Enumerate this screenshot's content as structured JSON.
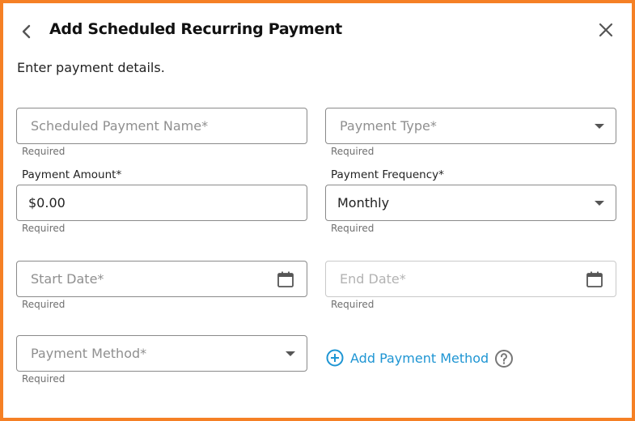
{
  "header": {
    "title": "Add Scheduled Recurring Payment",
    "back_icon": "chevron-left-icon",
    "close_icon": "close-icon"
  },
  "subtitle": "Enter payment details.",
  "fields": {
    "payment_name": {
      "placeholder": "Scheduled Payment Name*",
      "helper": "Required",
      "value": ""
    },
    "payment_type": {
      "placeholder": "Payment Type*",
      "helper": "Required",
      "value": ""
    },
    "payment_amount": {
      "label": "Payment Amount*",
      "value": "$0.00",
      "helper": "Required"
    },
    "payment_frequency": {
      "label": "Payment Frequency*",
      "value": "Monthly",
      "helper": "Required"
    },
    "start_date": {
      "placeholder": "Start Date*",
      "helper": "Required",
      "icon": "calendar-icon"
    },
    "end_date": {
      "placeholder": "End Date*",
      "helper": "Required",
      "icon": "calendar-icon",
      "disabled": true
    },
    "payment_method": {
      "placeholder": "Payment Method*",
      "helper": "Required",
      "value": ""
    }
  },
  "add_payment_method": {
    "label": "Add Payment Method",
    "icon": "plus-circle-icon"
  },
  "help_icon": "question-circle-icon",
  "colors": {
    "frame_border": "#f58025",
    "link": "#1e95d3",
    "field_border": "#8a8a8a",
    "placeholder": "#8f8f8f"
  }
}
